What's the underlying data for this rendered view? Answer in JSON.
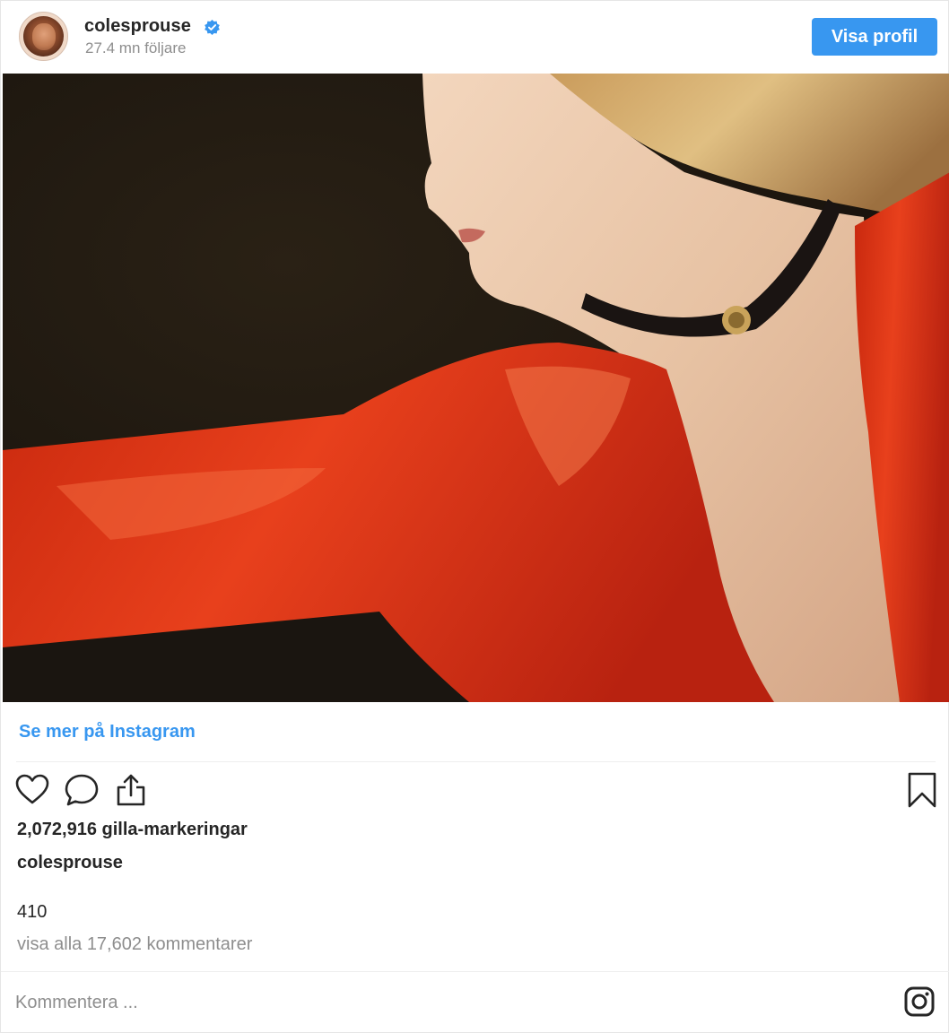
{
  "header": {
    "username": "colesprouse",
    "followers": "27.4 mn följare",
    "profile_button": "Visa profil"
  },
  "post": {
    "image_icon": "photo-of-woman-in-red-dress",
    "see_more_link": "Se mer på Instagram",
    "likes": "2,072,916 gilla-markeringar",
    "caption_user": "colesprouse",
    "caption_text": "410",
    "view_comments": "visa alla 17,602 kommentarer"
  },
  "actions": {
    "like_icon": "heart-icon",
    "comment_icon": "comment-icon",
    "share_icon": "share-icon",
    "save_icon": "bookmark-icon"
  },
  "comment": {
    "placeholder": "Kommentera ...",
    "instagram_icon": "instagram-icon"
  },
  "colors": {
    "accent": "#3897f0",
    "text": "#262626",
    "muted": "#8e8e8e",
    "verified": "#3897f0"
  }
}
